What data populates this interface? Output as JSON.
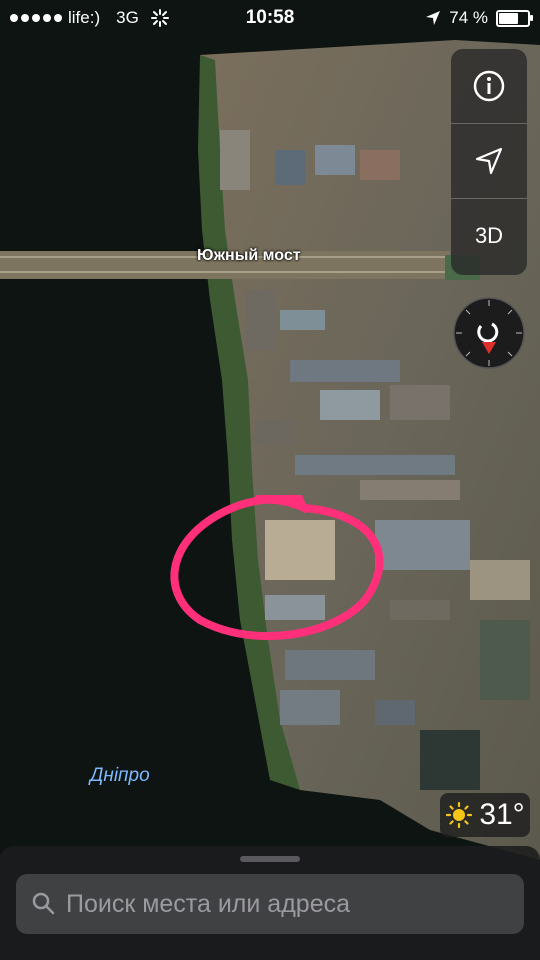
{
  "status_bar": {
    "carrier": "life:)",
    "network": "3G",
    "time": "10:58",
    "battery": "74 %",
    "battery_level": 0.74
  },
  "map": {
    "road_label": "Южный мост",
    "river_label": "Дніпро"
  },
  "controls": {
    "info_icon": "info-icon",
    "location_icon": "location-arrow-icon",
    "three_d_label": "3D"
  },
  "weather": {
    "temperature": "31°",
    "icon": "sun-icon"
  },
  "search": {
    "placeholder": "Поиск места или адреса"
  },
  "colors": {
    "water": "#0e1512",
    "annotation": "#ff2f7a",
    "river_label": "#7fb8ff"
  }
}
